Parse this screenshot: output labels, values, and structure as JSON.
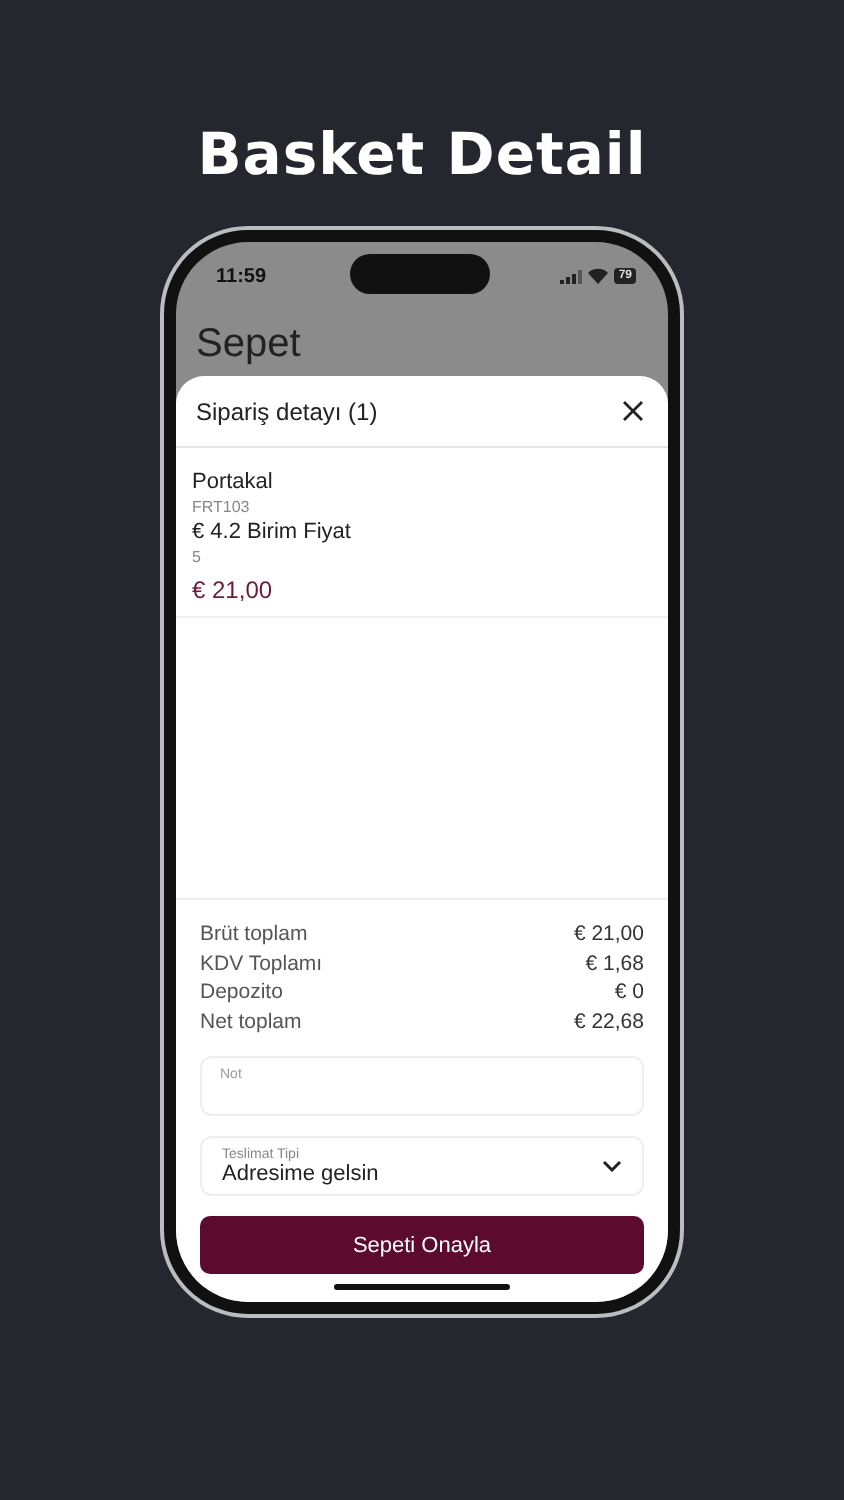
{
  "headline": "Basket Detail",
  "status_bar": {
    "time": "11:59",
    "battery": "79"
  },
  "page_title": "Sepet",
  "sheet": {
    "title": "Sipariş detayı (1)",
    "item": {
      "name": "Portakal",
      "code": "FRT103",
      "unit_price": "€ 4.2 Birim Fiyat",
      "quantity": "5",
      "total": "€ 21,00"
    },
    "totals": [
      {
        "label": "Brüt toplam",
        "value": "€ 21,00"
      },
      {
        "label": "KDV Toplamı",
        "value": "€ 1,68"
      },
      {
        "label": "Depozito",
        "value": "€ 0"
      },
      {
        "label": "Net toplam",
        "value": "€ 22,68"
      }
    ],
    "note": {
      "placeholder": "Not"
    },
    "delivery": {
      "label": "Teslimat Tipi",
      "value": "Adresime gelsin"
    },
    "confirm_button": "Sepeti Onayla"
  }
}
